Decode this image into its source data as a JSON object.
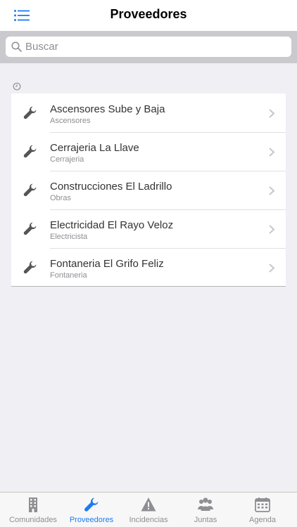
{
  "header": {
    "title": "Proveedores",
    "menu_icon": "list-menu-icon"
  },
  "search": {
    "placeholder": "Buscar",
    "value": ""
  },
  "section": {
    "icon": "clock-icon"
  },
  "providers": [
    {
      "name": "Ascensores Sube y Baja",
      "category": "Ascensores"
    },
    {
      "name": "Cerrajeria La Llave",
      "category": "Cerrajeria"
    },
    {
      "name": "Construcciones El Ladrillo",
      "category": "Obras"
    },
    {
      "name": "Electricidad El Rayo Veloz",
      "category": "Electricista"
    },
    {
      "name": "Fontaneria El Grifo Feliz",
      "category": "Fontaneria"
    }
  ],
  "tabs": [
    {
      "label": "Comunidades",
      "icon": "building-icon",
      "active": false
    },
    {
      "label": "Proveedores",
      "icon": "wrench-icon",
      "active": true
    },
    {
      "label": "Incidencias",
      "icon": "warning-icon",
      "active": false
    },
    {
      "label": "Juntas",
      "icon": "people-icon",
      "active": false
    },
    {
      "label": "Agenda",
      "icon": "calendar-icon",
      "active": false
    }
  ],
  "colors": {
    "accent": "#1a7cf2",
    "inactive": "#8e8e93",
    "background": "#efeff4"
  }
}
